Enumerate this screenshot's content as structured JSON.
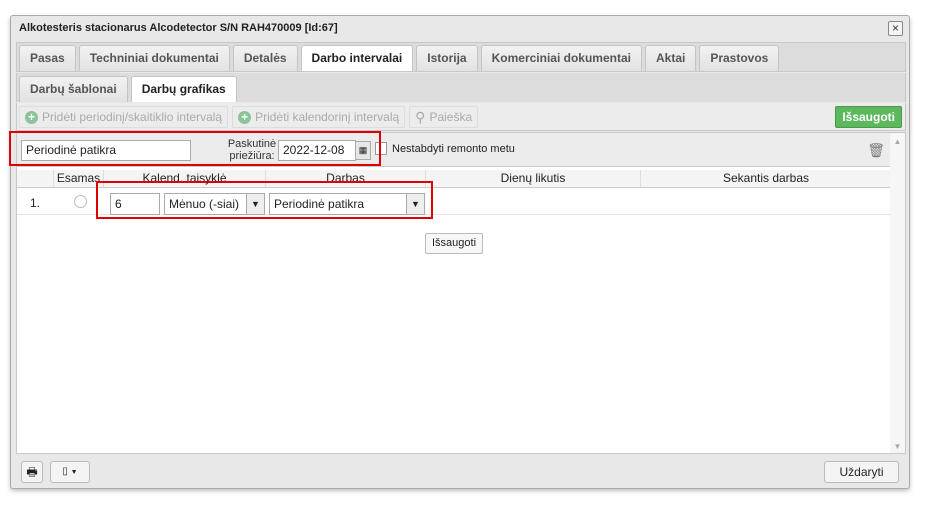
{
  "window": {
    "title": "Alkotesteris stacionarus Alcodetector S/N RAH470009 [Id:67]",
    "close": "×"
  },
  "tabs": [
    "Pasas",
    "Techniniai dokumentai",
    "Detalės",
    "Darbo intervalai",
    "Istorija",
    "Komerciniai dokumentai",
    "Aktai",
    "Prastovos"
  ],
  "subtabs": [
    "Darbų šablonai",
    "Darbų grafikas"
  ],
  "toolbar": {
    "add_periodic": "Pridėti periodinį/skaitiklio intervalą",
    "add_calendar": "Pridėti kalendorinį intervalą",
    "search": "Paieška",
    "save": "Išsaugoti"
  },
  "filter": {
    "name": "Periodinė patikra",
    "last_label": "Paskutinė priežiūra:",
    "last_date": "2022-12-08",
    "no_stop_label": "Nestabdyti remonto metu"
  },
  "table": {
    "headers": [
      "Esamas",
      "Kalend. taisyklė",
      "Darbas",
      "Dienų likutis",
      "Sekantis darbas"
    ],
    "rows": [
      {
        "num": "1.",
        "count": "6",
        "unit": "Mėnuo (-siai)",
        "work": "Periodinė patikra"
      }
    ],
    "row_save": "Išsaugoti"
  },
  "footer": {
    "close": "Uždaryti"
  }
}
